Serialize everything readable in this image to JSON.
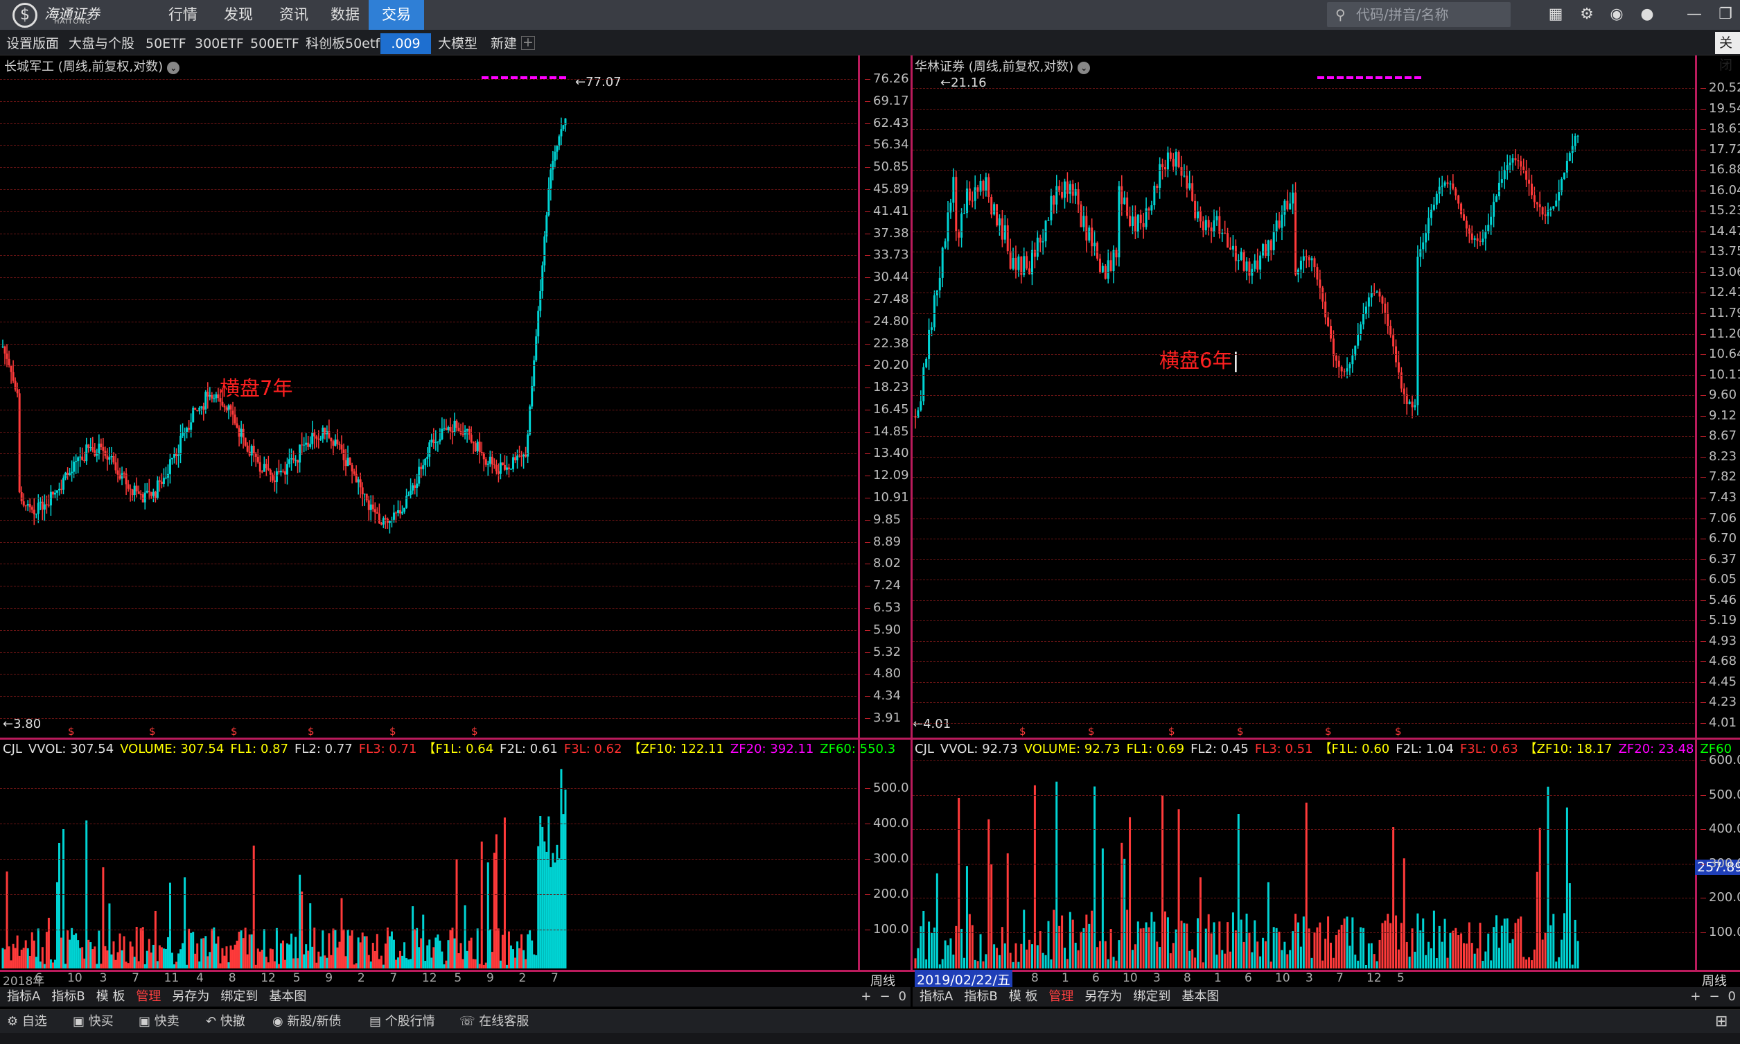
{
  "app": {
    "name": "海通证券",
    "name_en": "HAITONG"
  },
  "menu": [
    "行情",
    "发现",
    "资讯",
    "数据",
    "交易"
  ],
  "active_menu": "交易",
  "search_placeholder": "代码/拼音/名称",
  "tabs": [
    "设置版面",
    "大盘与个股",
    "50ETF",
    "300ETF",
    "500ETF",
    "科创板50etf",
    ".009",
    "大模型",
    "新建"
  ],
  "active_tab": ".009",
  "close_label": "关闭",
  "colors": {
    "up": "#ff3a3a",
    "down": "#00d4d4",
    "grid": "#6a1414",
    "frame": "#ba1b5c",
    "accent": "#2f7fd6",
    "magenta": "#ff00ff"
  },
  "left": {
    "title": "长城军工 (周线,前复权,对数)",
    "high_label": "77.07",
    "low_label": "3.80",
    "annotation": "横盘7年",
    "yticks": [
      "76.26",
      "69.17",
      "62.43",
      "56.34",
      "50.85",
      "45.89",
      "41.41",
      "37.38",
      "33.73",
      "30.44",
      "27.48",
      "24.80",
      "22.38",
      "20.20",
      "18.23",
      "16.45",
      "14.85",
      "13.40",
      "12.09",
      "10.91",
      "9.85",
      "8.89",
      "8.02",
      "7.24",
      "6.53",
      "5.90",
      "5.32",
      "4.80",
      "4.34",
      "3.91"
    ],
    "vol_ticks": [
      "500.0",
      "400.0",
      "300.0",
      "200.0",
      "100.0"
    ],
    "indicators": [
      [
        "CJL",
        "#e0e0e0"
      ],
      [
        "VVOL: 307.54",
        "#e0e0e0"
      ],
      [
        "VOLUME: 307.54",
        "#ffff00"
      ],
      [
        "FL1: 0.87",
        "#ffff00"
      ],
      [
        "FL2: 0.77",
        "#e0e0e0"
      ],
      [
        "FL3: 0.71",
        "#ff3030"
      ],
      [
        "【F1L: 0.64",
        "#ffff00"
      ],
      [
        "F2L: 0.61",
        "#e0e0e0"
      ],
      [
        "F3L: 0.62",
        "#ff3030"
      ],
      [
        "【ZF10: 122.11",
        "#ffff00"
      ],
      [
        "ZF20: 392.11",
        "#ff00ff"
      ],
      [
        "ZF60: 550.3",
        "#00ff00"
      ]
    ],
    "xlabels": [
      "2018年",
      "6",
      "10",
      "3",
      "7",
      "11",
      "4",
      "8",
      "12",
      "5",
      "9",
      "2",
      "7",
      "12",
      "5",
      "9",
      "2",
      "7"
    ],
    "period": "周线",
    "bottom": [
      "指标A",
      "指标B",
      "模 板",
      "管理",
      "另存为",
      "绑定到",
      "基本图"
    ]
  },
  "right": {
    "title": "华林证券 (周线,前复权,对数)",
    "high_label": "21.16",
    "low_label": "4.01",
    "annotation": "横盘6年",
    "yticks": [
      "20.52",
      "19.54",
      "18.61",
      "17.72",
      "16.88",
      "16.04",
      "15.23",
      "14.47",
      "13.75",
      "13.06",
      "12.41",
      "11.79",
      "11.20",
      "10.64",
      "10.11",
      "9.60",
      "9.12",
      "8.67",
      "8.23",
      "7.82",
      "7.43",
      "7.06",
      "6.70",
      "6.37",
      "6.05",
      "5.46",
      "5.19",
      "4.93",
      "4.68",
      "4.45",
      "4.23",
      "4.01"
    ],
    "vol_ticks": [
      "600.0",
      "500.0",
      "400.0",
      "300.0",
      "200.0",
      "100.0"
    ],
    "vol_marker": "257.89",
    "indicators": [
      [
        "CJL",
        "#e0e0e0"
      ],
      [
        "VVOL: 92.73",
        "#e0e0e0"
      ],
      [
        "VOLUME: 92.73",
        "#ffff00"
      ],
      [
        "FL1: 0.69",
        "#ffff00"
      ],
      [
        "FL2: 0.45",
        "#e0e0e0"
      ],
      [
        "FL3: 0.51",
        "#ff3030"
      ],
      [
        "【F1L: 0.60",
        "#ffff00"
      ],
      [
        "F2L: 1.04",
        "#e0e0e0"
      ],
      [
        "F3L: 0.63",
        "#ff3030"
      ],
      [
        "【ZF10: 18.17",
        "#ffff00"
      ],
      [
        "ZF20: 23.48",
        "#ff00ff"
      ],
      [
        "ZF60",
        "#00ff00"
      ]
    ],
    "date_box": "2019/02/22/五",
    "xlabels": [
      "8",
      "1",
      "6",
      "10",
      "3",
      "8",
      "1",
      "6",
      "10",
      "3",
      "7",
      "12",
      "5"
    ],
    "period": "周线",
    "bottom": [
      "指标A",
      "指标B",
      "模 板",
      "管理",
      "另存为",
      "绑定到",
      "基本图"
    ]
  },
  "bottom_nav": [
    "自选",
    "快买",
    "快卖",
    "快撤",
    "新股/新债",
    "个股行情",
    "在线客服"
  ],
  "zoom_controls": [
    "+",
    "−",
    "0"
  ]
}
